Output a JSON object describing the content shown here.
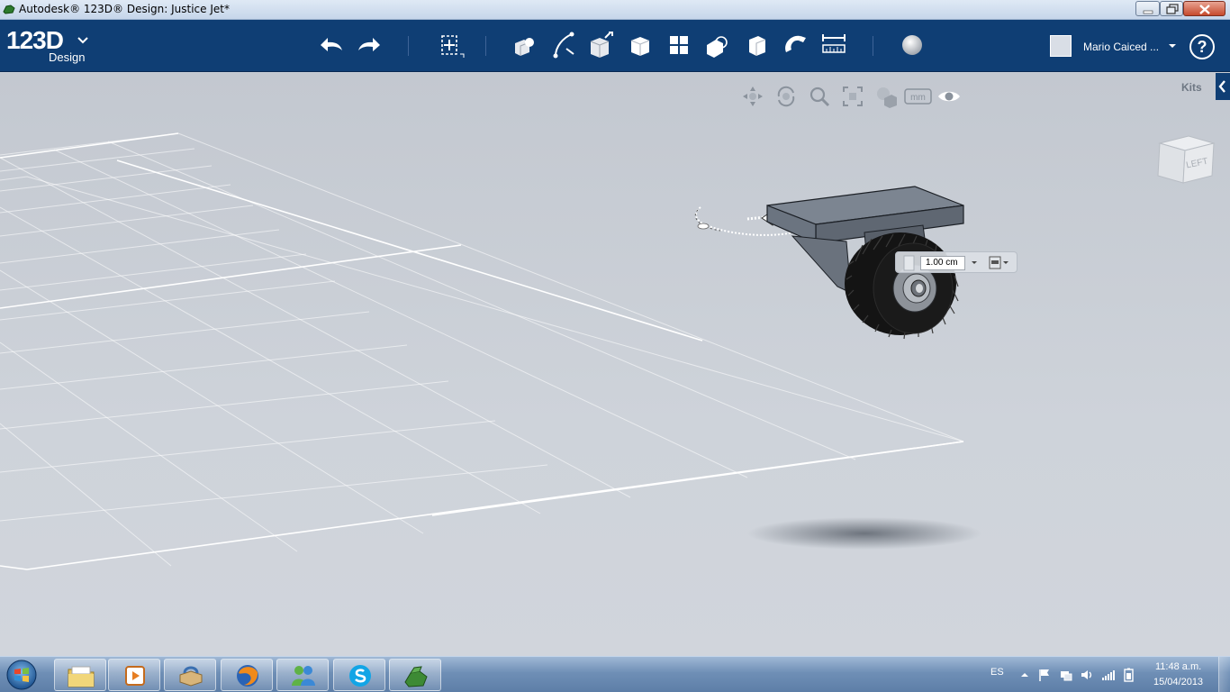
{
  "window": {
    "title": "Autodesk® 123D® Design: Justice Jet*",
    "controls": [
      "minimize",
      "maximize",
      "close"
    ]
  },
  "header": {
    "logo_number": "123D",
    "logo_sub": "Design",
    "toolbar": [
      {
        "name": "undo-icon"
      },
      {
        "name": "redo-icon"
      },
      {
        "name": "transform-icon"
      },
      {
        "name": "primitives-icon"
      },
      {
        "name": "sketch-icon"
      },
      {
        "name": "construct-icon"
      },
      {
        "name": "modify-icon"
      },
      {
        "name": "pattern-icon"
      },
      {
        "name": "grouping-icon"
      },
      {
        "name": "combine-icon"
      },
      {
        "name": "snap-icon"
      },
      {
        "name": "measure-icon"
      },
      {
        "name": "material-icon"
      }
    ],
    "user_name": "Mario Caiced ...",
    "help_label": "?"
  },
  "viewport": {
    "nav_tools": [
      "pan-icon",
      "orbit-icon",
      "zoom-icon",
      "fit-icon",
      "visual-style-icon",
      "units-icon",
      "visibility-icon"
    ],
    "units_label": "mm",
    "kits_label": "Kits",
    "viewcube_label": "LEFT",
    "dimension_value": "1.00 cm"
  },
  "taskbar": {
    "pinned_apps": [
      "file-explorer-icon",
      "media-player-icon",
      "game-icon",
      "firefox-icon",
      "messenger-icon",
      "skype-icon",
      "123d-design-icon"
    ],
    "language": "ES",
    "time": "11:48 a.m.",
    "date": "15/04/2013"
  },
  "colors": {
    "header_bg": "#0f3e74",
    "viewport_bg": "#c9ced6",
    "grid_line": "#ffffff",
    "model_gray": "#707985"
  }
}
